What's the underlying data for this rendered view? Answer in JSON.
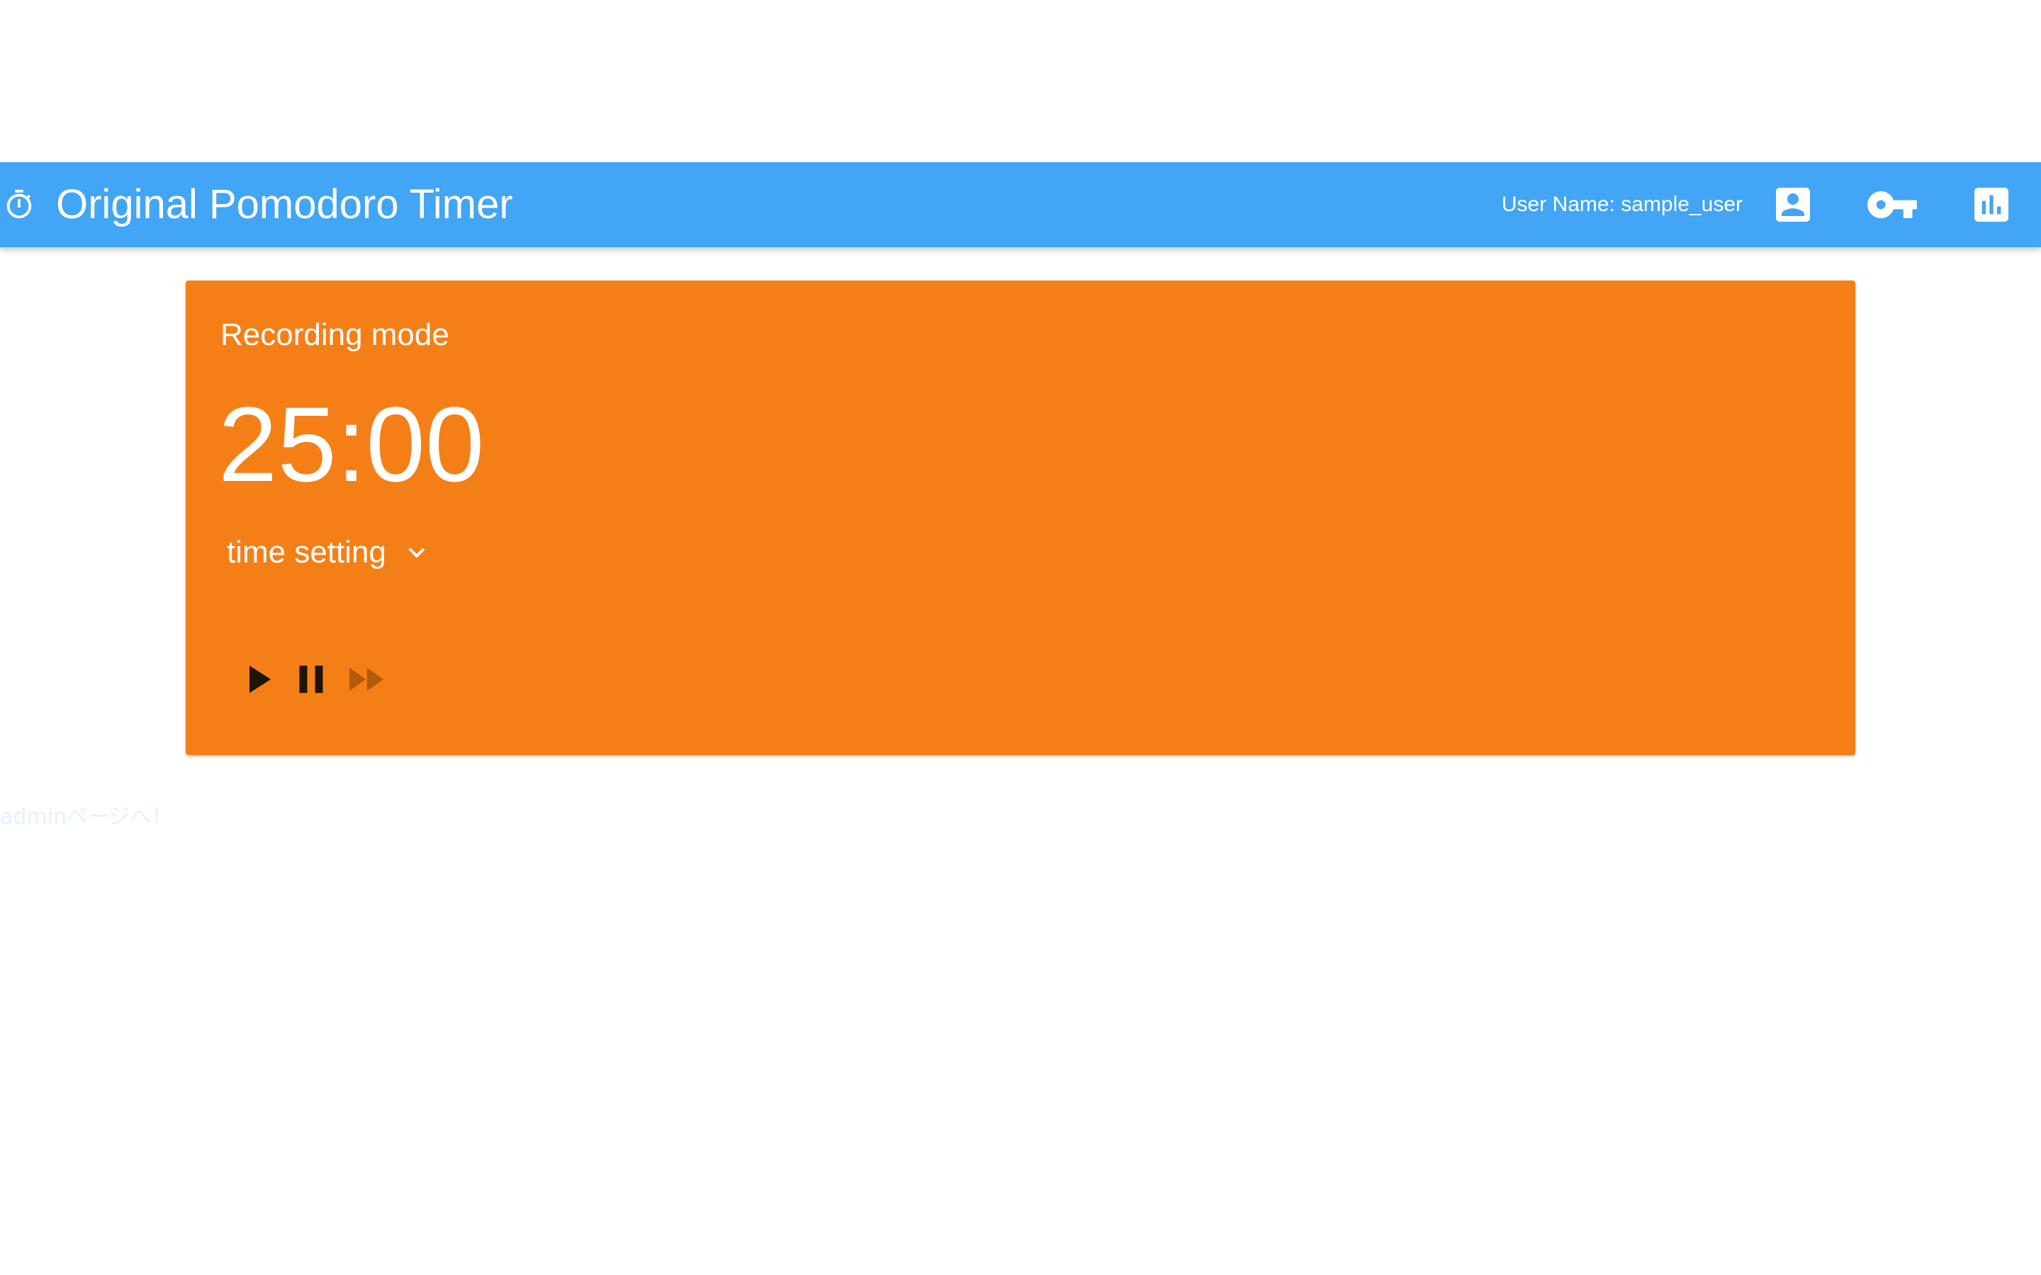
{
  "header": {
    "logo_icon": "timer-icon",
    "title": "Original Pomodoro Timer",
    "user_name": "User Name: sample_user",
    "actions": [
      {
        "icon": "account-box-icon"
      },
      {
        "icon": "vpn-key-icon"
      },
      {
        "icon": "bar-chart-icon"
      }
    ],
    "background_color": "#42a5f5"
  },
  "timer_card": {
    "mode": "Recording mode",
    "time": "25:00",
    "time_setting_label": "time setting",
    "time_setting_icon": "chevron-down-icon",
    "background_color": "#f57f17",
    "controls": [
      {
        "icon": "play-icon",
        "enabled": true
      },
      {
        "icon": "pause-icon",
        "enabled": true
      },
      {
        "icon": "fast-forward-icon",
        "enabled": false
      }
    ]
  },
  "footer": {
    "admin_link": "adminページへ！"
  }
}
